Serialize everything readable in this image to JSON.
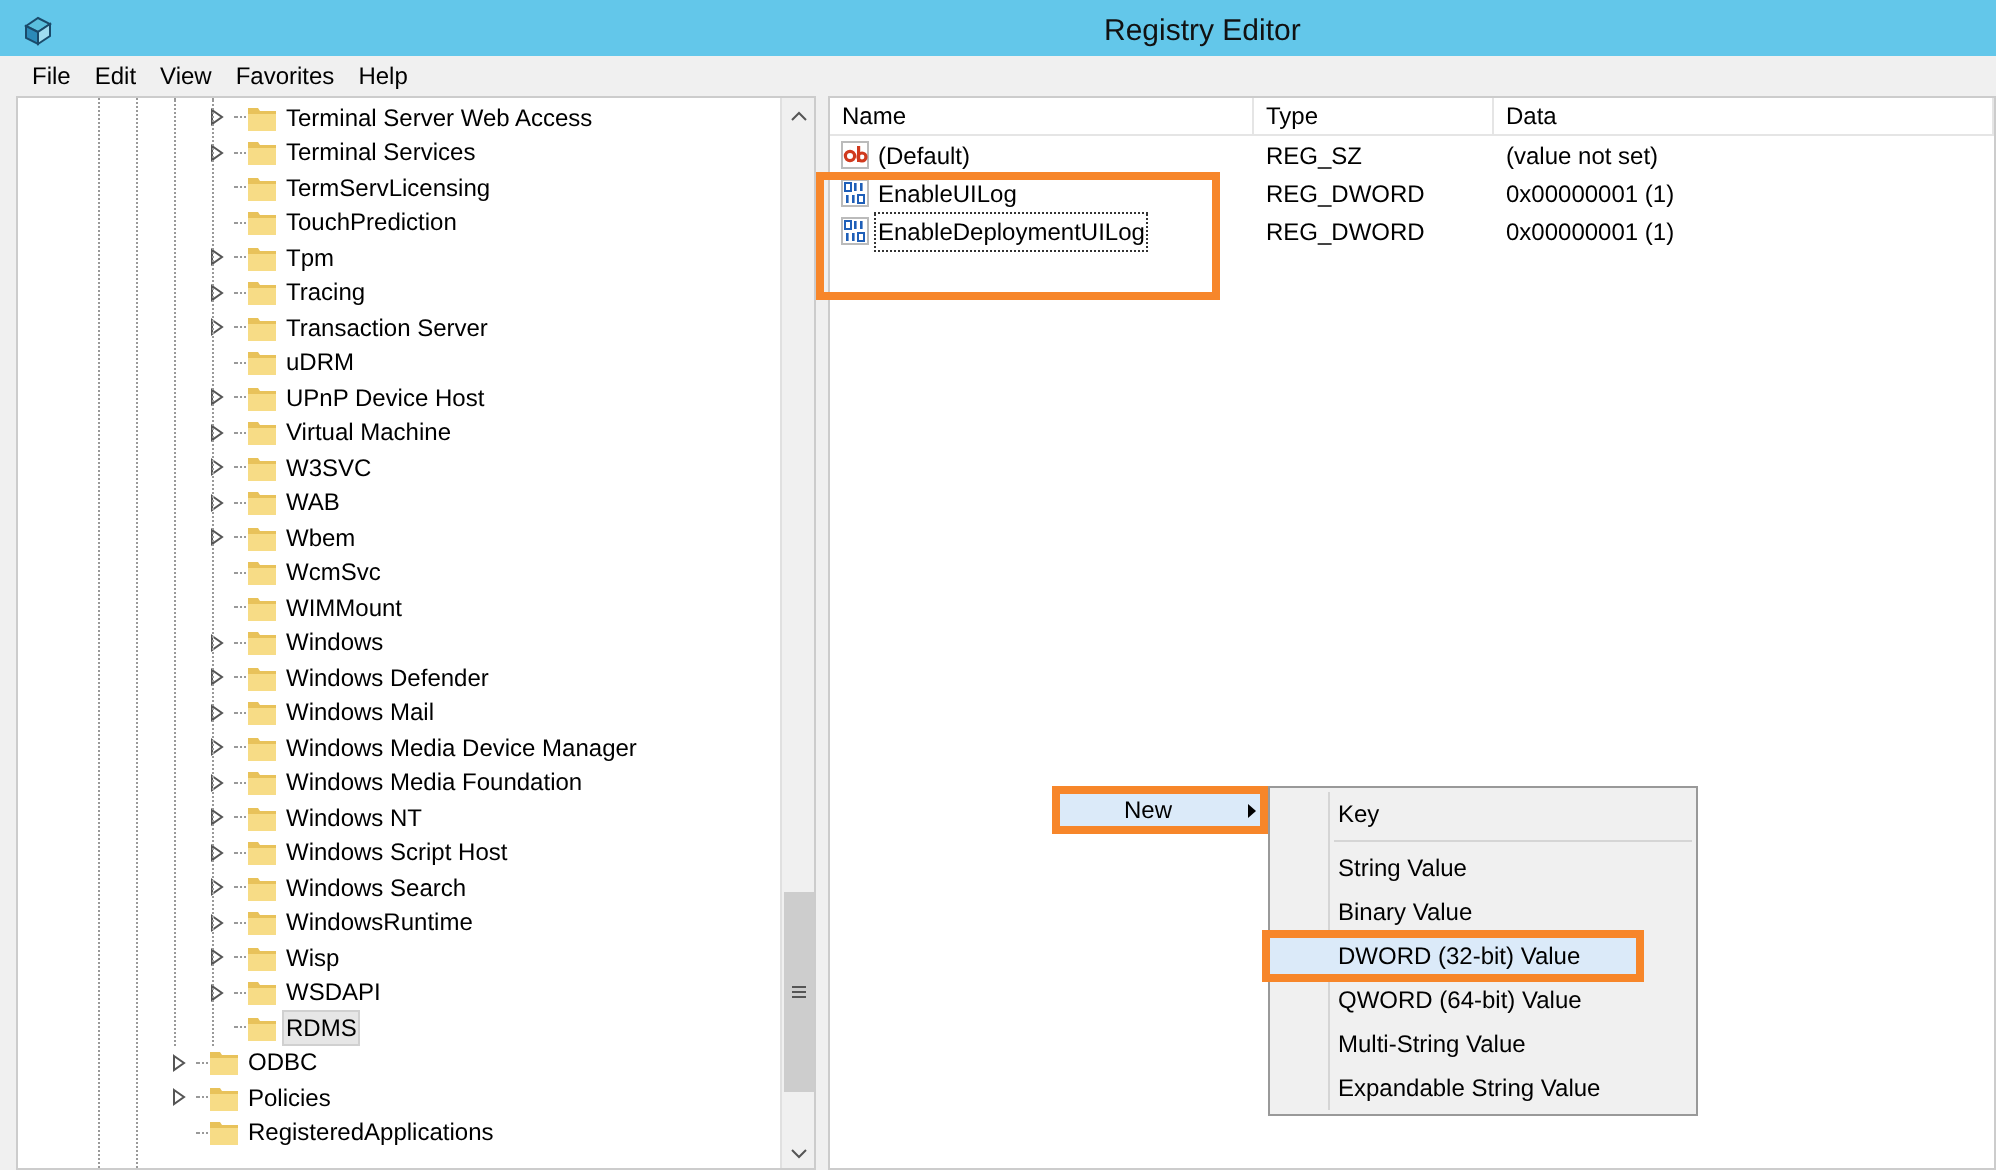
{
  "window": {
    "title": "Registry Editor"
  },
  "menu_bar": [
    "File",
    "Edit",
    "View",
    "Favorites",
    "Help"
  ],
  "tree": [
    {
      "children": [
        {
          "label": "Terminal Server Web Access",
          "expandable": true,
          "selected": false
        },
        {
          "label": "Terminal Services",
          "expandable": true,
          "selected": false
        },
        {
          "label": "TermServLicensing",
          "expandable": false,
          "selected": false
        },
        {
          "label": "TouchPrediction",
          "expandable": false,
          "selected": false
        },
        {
          "label": "Tpm",
          "expandable": true,
          "selected": false
        },
        {
          "label": "Tracing",
          "expandable": true,
          "selected": false
        },
        {
          "label": "Transaction Server",
          "expandable": true,
          "selected": false
        },
        {
          "label": "uDRM",
          "expandable": false,
          "selected": false
        },
        {
          "label": "UPnP Device Host",
          "expandable": true,
          "selected": false
        },
        {
          "label": "Virtual Machine",
          "expandable": true,
          "selected": false
        },
        {
          "label": "W3SVC",
          "expandable": true,
          "selected": false
        },
        {
          "label": "WAB",
          "expandable": true,
          "selected": false
        },
        {
          "label": "Wbem",
          "expandable": true,
          "selected": false
        },
        {
          "label": "WcmSvc",
          "expandable": false,
          "selected": false
        },
        {
          "label": "WIMMount",
          "expandable": false,
          "selected": false
        },
        {
          "label": "Windows",
          "expandable": true,
          "selected": false
        },
        {
          "label": "Windows Defender",
          "expandable": true,
          "selected": false
        },
        {
          "label": "Windows Mail",
          "expandable": true,
          "selected": false
        },
        {
          "label": "Windows Media Device Manager",
          "expandable": true,
          "selected": false
        },
        {
          "label": "Windows Media Foundation",
          "expandable": true,
          "selected": false
        },
        {
          "label": "Windows NT",
          "expandable": true,
          "selected": false
        },
        {
          "label": "Windows Script Host",
          "expandable": true,
          "selected": false
        },
        {
          "label": "Windows Search",
          "expandable": true,
          "selected": false
        },
        {
          "label": "WindowsRuntime",
          "expandable": true,
          "selected": false
        },
        {
          "label": "Wisp",
          "expandable": true,
          "selected": false
        },
        {
          "label": "WSDAPI",
          "expandable": true,
          "selected": false
        },
        {
          "label": "RDMS",
          "expandable": false,
          "selected": true
        }
      ]
    },
    {
      "label": "ODBC",
      "expandable": true,
      "selected": false
    },
    {
      "label": "Policies",
      "expandable": true,
      "selected": false
    },
    {
      "label": "RegisteredApplications",
      "expandable": false,
      "selected": false
    }
  ],
  "values": {
    "columns": [
      "Name",
      "Type",
      "Data"
    ],
    "rows": [
      {
        "kind": "string",
        "name": "(Default)",
        "type": "REG_SZ",
        "data": "(value not set)",
        "focused": false,
        "highlighted": false
      },
      {
        "kind": "binary",
        "name": "EnableUILog",
        "type": "REG_DWORD",
        "data": "0x00000001 (1)",
        "focused": false,
        "highlighted": true
      },
      {
        "kind": "binary",
        "name": "EnableDeploymentUILog",
        "type": "REG_DWORD",
        "data": "0x00000001 (1)",
        "focused": true,
        "highlighted": true
      }
    ]
  },
  "context_menu": {
    "items": [
      {
        "label": "New",
        "submenu": true,
        "selected": true,
        "highlighted": true
      }
    ]
  },
  "submenu": {
    "items": [
      {
        "label": "Key",
        "selected": false,
        "highlighted": false,
        "separator_after": true
      },
      {
        "label": "String Value",
        "selected": false,
        "highlighted": false,
        "separator_after": false
      },
      {
        "label": "Binary Value",
        "selected": false,
        "highlighted": false,
        "separator_after": false
      },
      {
        "label": "DWORD (32-bit) Value",
        "selected": true,
        "highlighted": true,
        "separator_after": false
      },
      {
        "label": "QWORD (64-bit) Value",
        "selected": false,
        "highlighted": false,
        "separator_after": false
      },
      {
        "label": "Multi-String Value",
        "selected": false,
        "highlighted": false,
        "separator_after": false
      },
      {
        "label": "Expandable String Value",
        "selected": false,
        "highlighted": false,
        "separator_after": false
      }
    ]
  }
}
